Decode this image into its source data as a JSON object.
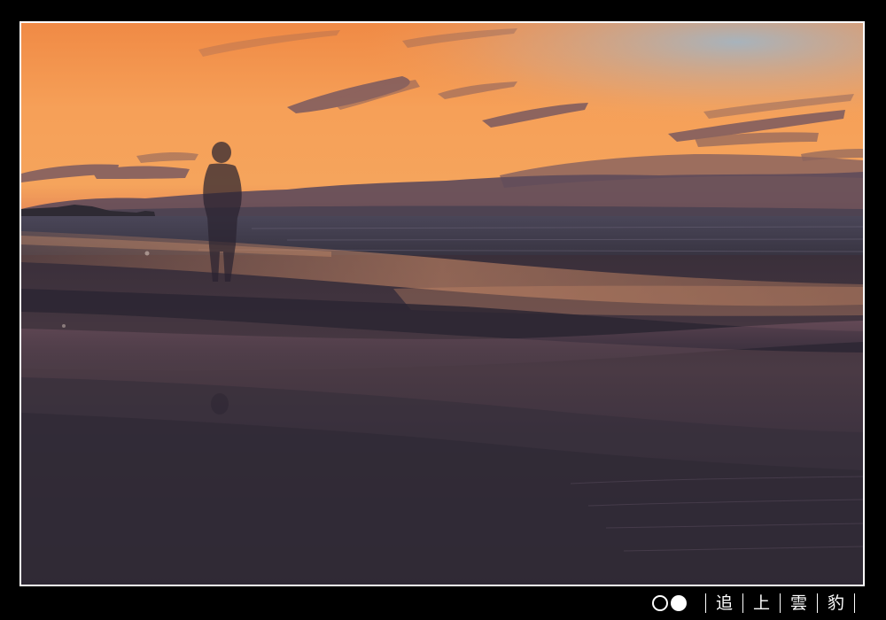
{
  "photo": {
    "subject": "silhouette-on-beach-at-sunset",
    "colors": {
      "sky_top": "#f49a4e",
      "sky_horizon": "#f7a25a",
      "sky_blue_patch": "#9fb7c9",
      "cloud": "#5e4a5a",
      "sea": "#3c3a4c",
      "sand_dark": "#2a2431",
      "reflection": "#c98662",
      "border": "#ffffff"
    }
  },
  "signature": {
    "circle_open_icon": "circle-open-icon",
    "circle_filled_icon": "circle-filled-icon",
    "chars": [
      "追",
      "上",
      "雲",
      "豹"
    ]
  }
}
